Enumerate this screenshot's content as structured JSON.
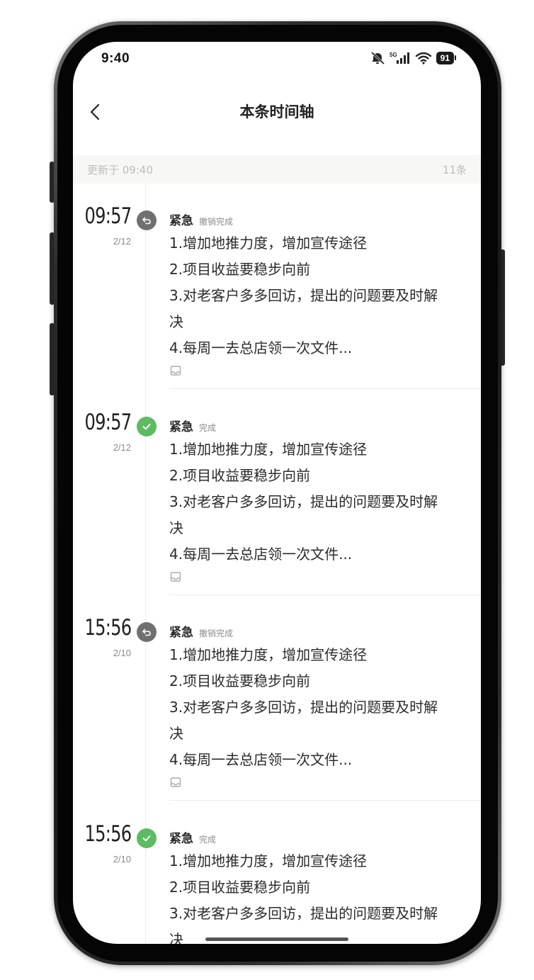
{
  "status_bar": {
    "time": "9:40",
    "network": "5G",
    "battery": "91"
  },
  "header": {
    "title": "本条时间轴"
  },
  "update_bar": {
    "updated_text": "更新于 09:40",
    "count_text": "11条"
  },
  "entries": [
    {
      "time": "09:57",
      "date": "2/12",
      "status_type": "undo",
      "priority": "紧急",
      "status_label": "撤销完成",
      "lines": [
        "1.增加地推力度，增加宣传途径",
        "2.项目收益要稳步向前",
        "3.对老客户多多回访，提出的问题要及时解",
        "决",
        "4.每周一去总店领一次文件..."
      ]
    },
    {
      "time": "09:57",
      "date": "2/12",
      "status_type": "done",
      "priority": "紧急",
      "status_label": "完成",
      "lines": [
        "1.增加地推力度，增加宣传途径",
        "2.项目收益要稳步向前",
        "3.对老客户多多回访，提出的问题要及时解",
        "决",
        "4.每周一去总店领一次文件..."
      ]
    },
    {
      "time": "15:56",
      "date": "2/10",
      "status_type": "undo",
      "priority": "紧急",
      "status_label": "撤销完成",
      "lines": [
        "1.增加地推力度，增加宣传途径",
        "2.项目收益要稳步向前",
        "3.对老客户多多回访，提出的问题要及时解",
        "决",
        "4.每周一去总店领一次文件..."
      ]
    },
    {
      "time": "15:56",
      "date": "2/10",
      "status_type": "done",
      "priority": "紧急",
      "status_label": "完成",
      "lines": [
        "1.增加地推力度，增加宣传途径",
        "2.项目收益要稳步向前",
        "3.对老客户多多回访，提出的问题要及时解",
        "决"
      ]
    }
  ],
  "icons": {
    "back": "chevron-left-icon",
    "undo": "undo-icon",
    "done": "check-icon",
    "attachment": "tray-icon"
  },
  "colors": {
    "done": "#5dbb63",
    "undo": "#707070"
  }
}
